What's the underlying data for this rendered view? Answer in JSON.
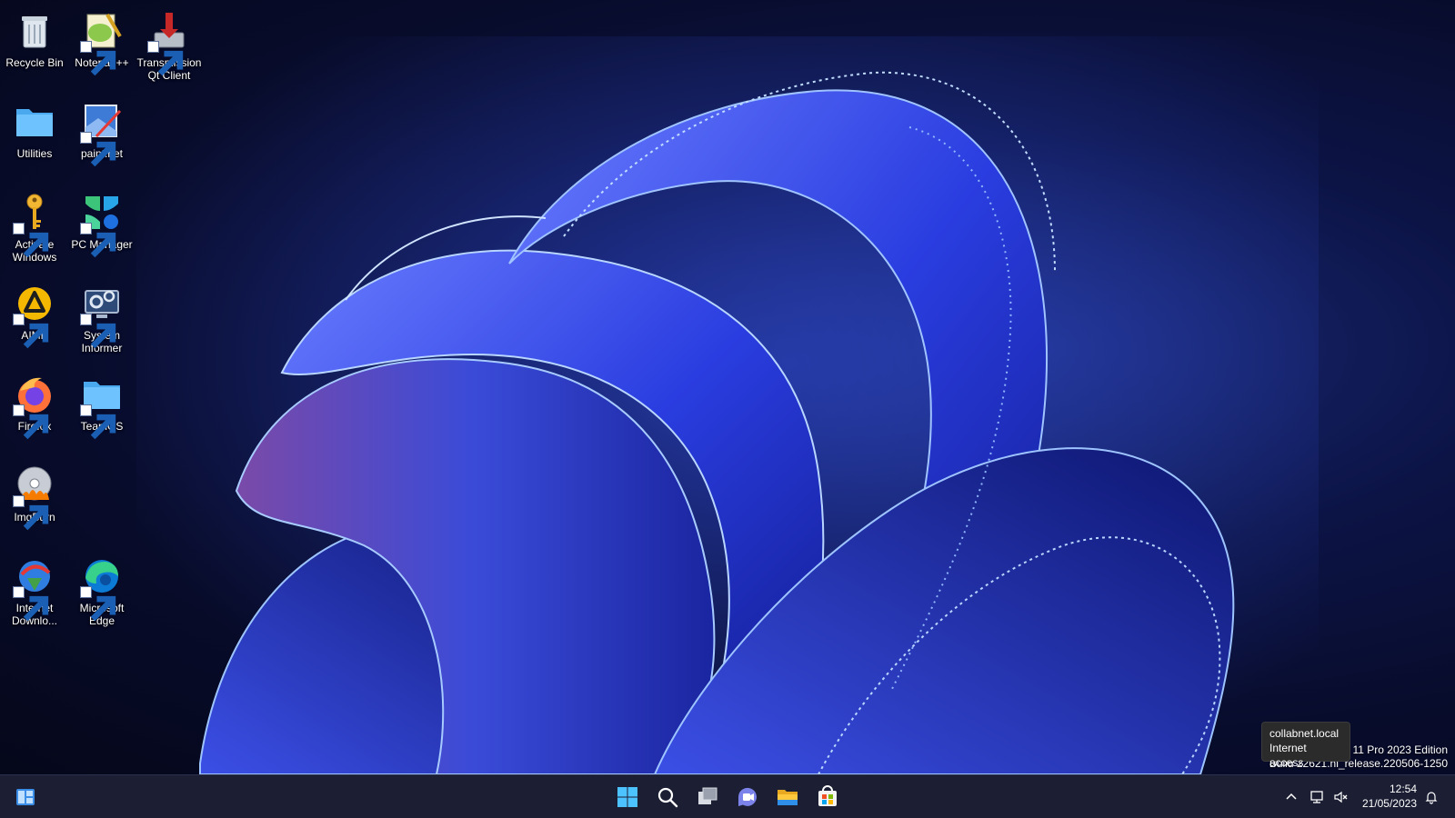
{
  "desktop": {
    "icons": [
      {
        "label": "Recycle Bin"
      },
      {
        "label": "Notepad++"
      },
      {
        "label": "Transmission Qt Client"
      },
      {
        "label": "Utilities"
      },
      {
        "label": "paint.net"
      },
      {
        "label": "Activate Windows"
      },
      {
        "label": "PC Manager"
      },
      {
        "label": "AIMP"
      },
      {
        "label": "System Informer"
      },
      {
        "label": "Firefox"
      },
      {
        "label": "TeamOS"
      },
      {
        "label": "ImgBurn"
      },
      {
        "label": "Internet Downlo..."
      },
      {
        "label": "Microsoft Edge"
      }
    ]
  },
  "tooltip": {
    "line1": "collabnet.local",
    "line2": "Internet access"
  },
  "watermark": {
    "line1": "vs 11 Pro 2023 Edition",
    "line2": "Build 22621.ni_release.220506-1250"
  },
  "taskbar": {
    "widgets_icon": "widgets-icon",
    "start_icon": "windows-start-icon",
    "search_icon": "search-icon",
    "taskview_icon": "task-view-icon",
    "chat_icon": "teams-chat-icon",
    "explorer_icon": "file-explorer-icon",
    "store_icon": "microsoft-store-icon",
    "accent": "#4cc2ff"
  },
  "tray": {
    "chevron_icon": "chevron-up-icon",
    "network_icon": "network-icon",
    "volume_icon": "volume-muted-icon",
    "time": "12:54",
    "date": "21/05/2023",
    "notification_icon": "notification-bell-icon"
  }
}
